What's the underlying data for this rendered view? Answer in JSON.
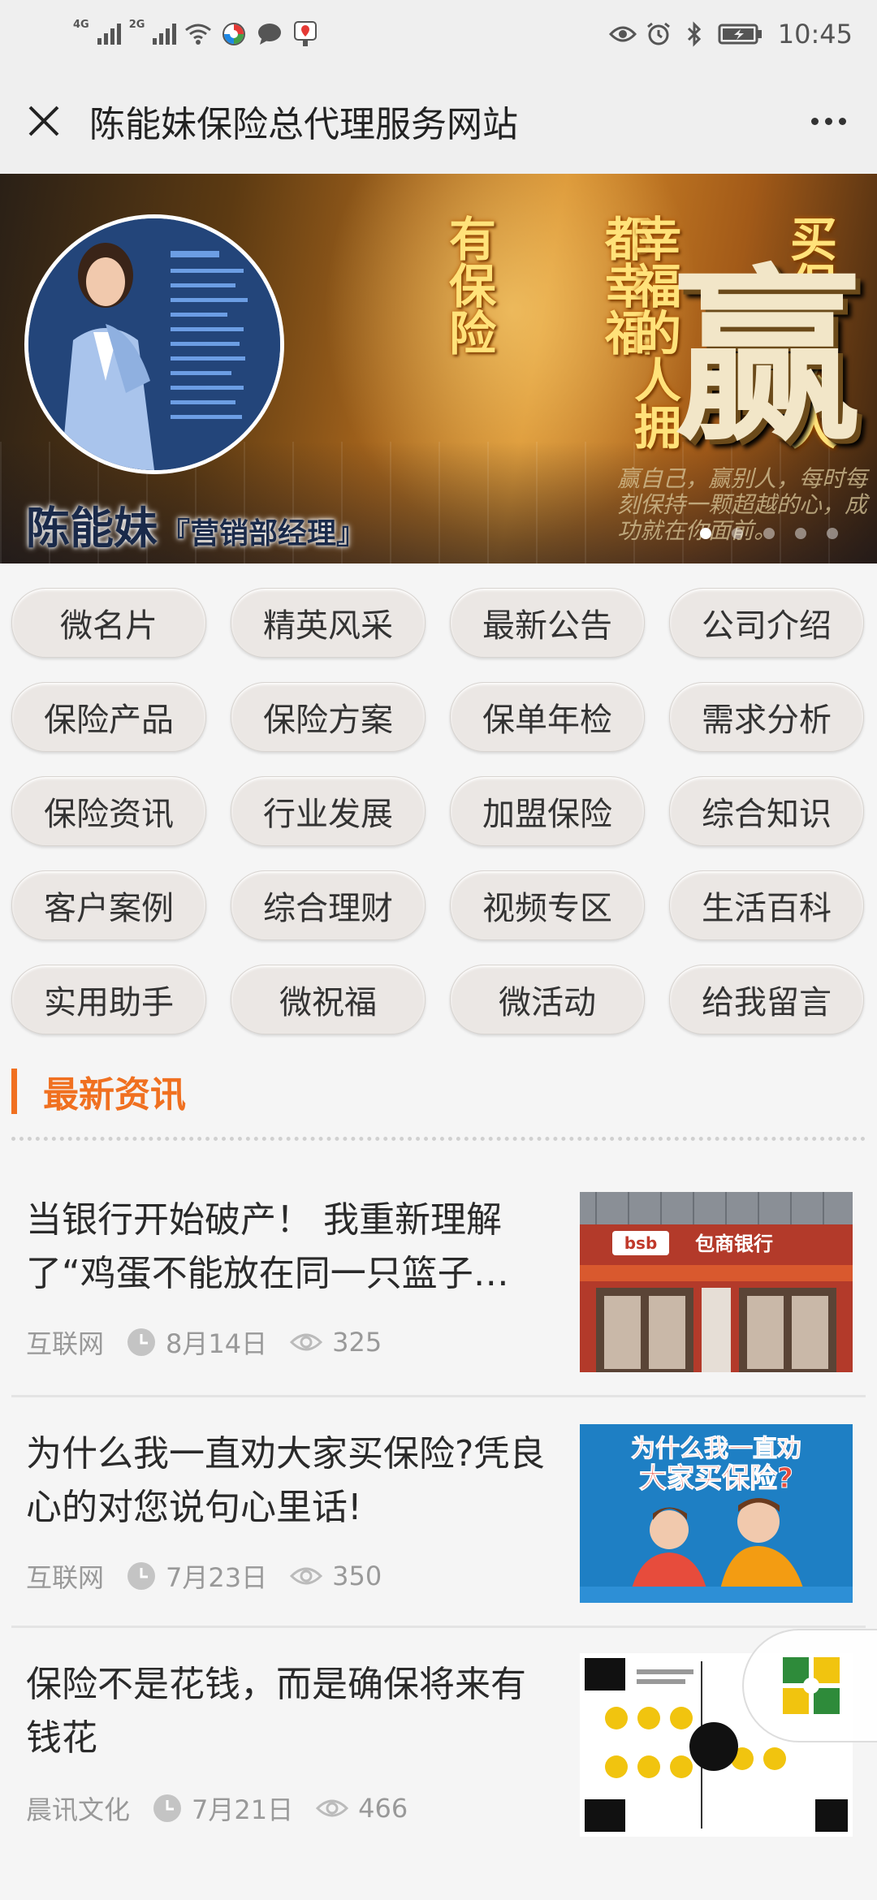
{
  "status_bar": {
    "network1": "4G",
    "network2": "2G",
    "time": "10:45",
    "icons": [
      "signal-icon",
      "wifi-icon",
      "app-icon",
      "chat-icon",
      "map-icon",
      "eye-icon",
      "alarm-icon",
      "bluetooth-icon",
      "battery-icon"
    ]
  },
  "header": {
    "title": "陈能妹保险总代理服务网站"
  },
  "banner": {
    "poem_columns": [
      "买保险的人",
      "都幸福",
      "幸福的人拥",
      "有保险"
    ],
    "big_char": "赢",
    "subtitle": "赢自己，赢别人，每时每刻保持一颗超越的心，成功就在你面前。",
    "agent_name": "陈能妹",
    "agent_role": "『营销部经理』",
    "slide_count": 5,
    "active_slide": 1
  },
  "menu": {
    "items": [
      "微名片",
      "精英风采",
      "最新公告",
      "公司介绍",
      "保险产品",
      "保险方案",
      "保单年检",
      "需求分析",
      "保险资讯",
      "行业发展",
      "加盟保险",
      "综合知识",
      "客户案例",
      "综合理财",
      "视频专区",
      "生活百科",
      "实用助手",
      "微祝福",
      "微活动",
      "给我留言"
    ]
  },
  "news": {
    "section_title": "最新资讯",
    "articles": [
      {
        "title": "当银行开始破产！ 我重新理解了“鸡蛋不能放在同一只篮子…",
        "source": "互联网",
        "date": "8月14日",
        "views": "325",
        "thumb_text": "bsb 包商银行"
      },
      {
        "title": "为什么我一直劝大家买保险?凭良心的对您说句心里话!",
        "source": "互联网",
        "date": "7月23日",
        "views": "350",
        "thumb_text": "为什么我一直劝大家买保险?"
      },
      {
        "title": "保险不是花钱，而是确保将来有钱花",
        "source": "晨讯文化",
        "date": "7月21日",
        "views": "466",
        "thumb_text": ""
      }
    ]
  },
  "colors": {
    "accent": "#f07020",
    "background": "#f5f5f5",
    "button_bg": "#ebe7e4"
  }
}
